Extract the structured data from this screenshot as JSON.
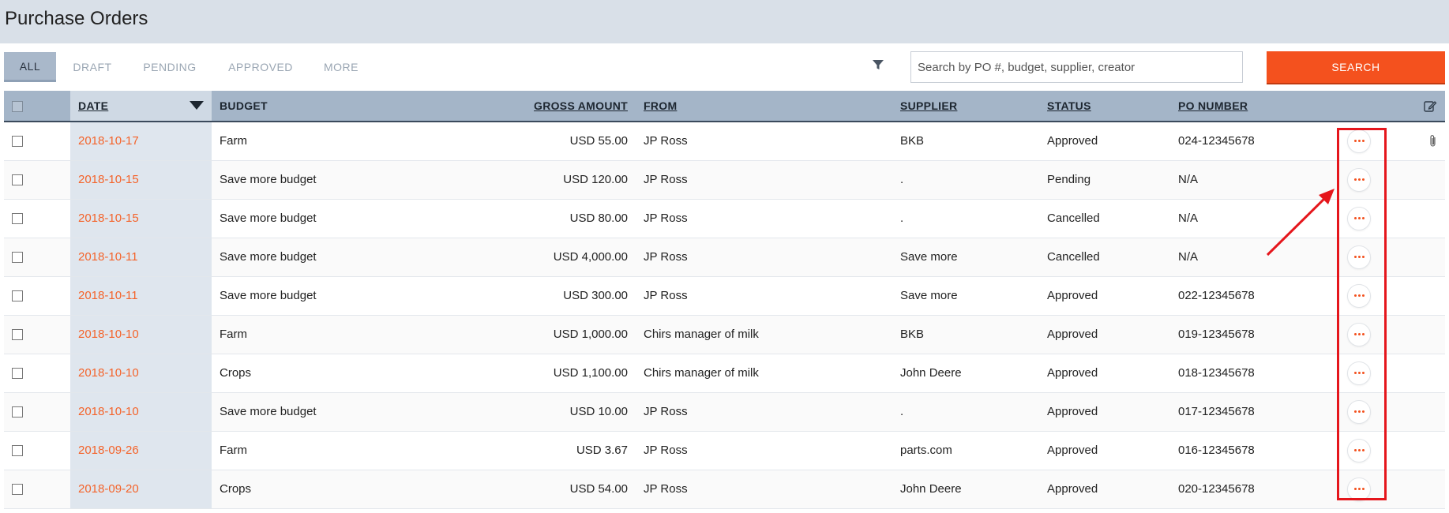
{
  "page": {
    "title": "Purchase Orders"
  },
  "tabs": [
    {
      "label": "ALL",
      "active": true
    },
    {
      "label": "DRAFT"
    },
    {
      "label": "PENDING"
    },
    {
      "label": "APPROVED"
    },
    {
      "label": "MORE"
    }
  ],
  "search": {
    "placeholder": "Search by PO #, budget, supplier, creator",
    "button_label": "SEARCH"
  },
  "table": {
    "headers": {
      "date": "DATE",
      "budget": "BUDGET",
      "gross_amount": "GROSS AMOUNT",
      "from": "FROM",
      "supplier": "SUPPLIER",
      "status": "STATUS",
      "po_number": "PO NUMBER"
    },
    "rows": [
      {
        "date": "2018-10-17",
        "budget": "Farm",
        "amount": "USD 55.00",
        "from": "JP Ross",
        "supplier": "BKB",
        "status": "Approved",
        "po": "024-12345678",
        "attachment": true
      },
      {
        "date": "2018-10-15",
        "budget": "Save more budget",
        "amount": "USD 120.00",
        "from": "JP Ross",
        "supplier": ".",
        "status": "Pending",
        "po": "N/A"
      },
      {
        "date": "2018-10-15",
        "budget": "Save more budget",
        "amount": "USD 80.00",
        "from": "JP Ross",
        "supplier": ".",
        "status": "Cancelled",
        "po": "N/A"
      },
      {
        "date": "2018-10-11",
        "budget": "Save more budget",
        "amount": "USD 4,000.00",
        "from": "JP Ross",
        "supplier": "Save more",
        "status": "Cancelled",
        "po": "N/A"
      },
      {
        "date": "2018-10-11",
        "budget": "Save more budget",
        "amount": "USD 300.00",
        "from": "JP Ross",
        "supplier": "Save more",
        "status": "Approved",
        "po": "022-12345678"
      },
      {
        "date": "2018-10-10",
        "budget": "Farm",
        "amount": "USD 1,000.00",
        "from": "Chirs manager of milk",
        "supplier": "BKB",
        "status": "Approved",
        "po": "019-12345678"
      },
      {
        "date": "2018-10-10",
        "budget": "Crops",
        "amount": "USD 1,100.00",
        "from": "Chirs manager of milk",
        "supplier": "John Deere",
        "status": "Approved",
        "po": "018-12345678"
      },
      {
        "date": "2018-10-10",
        "budget": "Save more budget",
        "amount": "USD 10.00",
        "from": "JP Ross",
        "supplier": ".",
        "status": "Approved",
        "po": "017-12345678"
      },
      {
        "date": "2018-09-26",
        "budget": "Farm",
        "amount": "USD 3.67",
        "from": "JP Ross",
        "supplier": "parts.com",
        "status": "Approved",
        "po": "016-12345678"
      },
      {
        "date": "2018-09-20",
        "budget": "Crops",
        "amount": "USD 54.00",
        "from": "JP Ross",
        "supplier": "John Deere",
        "status": "Approved",
        "po": "020-12345678"
      }
    ]
  },
  "colors": {
    "accent": "#f4511e",
    "date_link": "#f4632a",
    "header_bg": "#d9e0e8",
    "table_header_bg": "#a4b5c8",
    "annotation": "#e5161c"
  },
  "icons": {
    "filter": "filter-icon",
    "edit": "edit-icon",
    "attachment": "paperclip-icon",
    "row_actions": "more-horizontal-icon"
  }
}
